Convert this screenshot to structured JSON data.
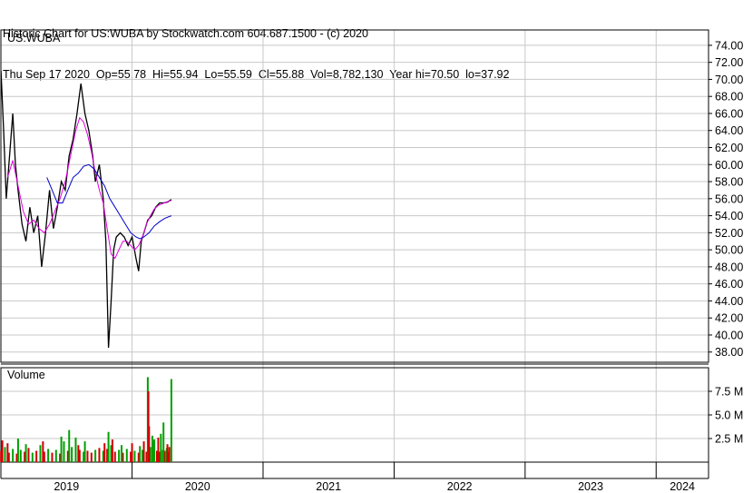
{
  "header": {
    "line1": "Historic Chart for US:WUBA by Stockwatch.com 604.687.1500 - (c) 2020",
    "line2": "Thu Sep 17 2020  Op=55.78  Hi=55.94  Lo=55.59  Cl=55.88  Vol=8,782,130  Year hi=70.50  lo=37.92"
  },
  "chart_data": {
    "type": "line",
    "symbol_label": "US:WUBA",
    "volume_label": "Volume",
    "price_axis": {
      "range": [
        36.8,
        75.8
      ],
      "ticks": [
        "74.00",
        "72.00",
        "70.00",
        "68.00",
        "66.00",
        "64.00",
        "62.00",
        "60.00",
        "58.00",
        "56.00",
        "54.00",
        "52.00",
        "50.00",
        "48.00",
        "46.00",
        "44.00",
        "42.00",
        "40.00",
        "38.00"
      ]
    },
    "volume_axis": {
      "range": [
        0,
        10
      ],
      "unit": "M",
      "ticks": [
        "7.5 M",
        "5.0 M",
        "2.5 M"
      ]
    },
    "x_axis": {
      "years": [
        "2019",
        "2020",
        "2021",
        "2022",
        "2023",
        "2024"
      ],
      "year_start": [
        2018.999,
        2020.0,
        2021.0,
        2022.0,
        2023.0,
        2024.0
      ],
      "range": [
        2018.999,
        2024.4
      ]
    },
    "colors": {
      "price": "#000000",
      "ma_short": "#e000e0",
      "ma_long": "#0000c8",
      "vol_up": "#00a000",
      "vol_down": "#d00000",
      "grid": "#c8c8c8"
    },
    "series": [
      {
        "key": "close",
        "points": [
          [
            2019.0,
            71.0
          ],
          [
            2019.02,
            64.0
          ],
          [
            2019.04,
            56.0
          ],
          [
            2019.06,
            60.0
          ],
          [
            2019.09,
            66.0
          ],
          [
            2019.11,
            60.0
          ],
          [
            2019.13,
            57.0
          ],
          [
            2019.16,
            53.0
          ],
          [
            2019.19,
            51.0
          ],
          [
            2019.22,
            55.0
          ],
          [
            2019.25,
            52.0
          ],
          [
            2019.28,
            54.0
          ],
          [
            2019.31,
            48.0
          ],
          [
            2019.34,
            52.0
          ],
          [
            2019.37,
            57.0
          ],
          [
            2019.4,
            52.5
          ],
          [
            2019.43,
            55.0
          ],
          [
            2019.46,
            58.0
          ],
          [
            2019.49,
            57.0
          ],
          [
            2019.52,
            61.0
          ],
          [
            2019.55,
            63.0
          ],
          [
            2019.58,
            66.0
          ],
          [
            2019.61,
            69.5
          ],
          [
            2019.64,
            66.0
          ],
          [
            2019.67,
            64.0
          ],
          [
            2019.7,
            61.0
          ],
          [
            2019.72,
            58.0
          ],
          [
            2019.75,
            60.0
          ],
          [
            2019.78,
            56.0
          ],
          [
            2019.8,
            51.0
          ],
          [
            2019.81,
            45.0
          ],
          [
            2019.82,
            38.5
          ],
          [
            2019.84,
            44.0
          ],
          [
            2019.86,
            50.0
          ],
          [
            2019.88,
            51.5
          ],
          [
            2019.91,
            52.0
          ],
          [
            2019.94,
            51.5
          ],
          [
            2019.97,
            50.5
          ],
          [
            2020.0,
            51.5
          ],
          [
            2020.03,
            49.0
          ],
          [
            2020.05,
            47.5
          ],
          [
            2020.07,
            51.0
          ],
          [
            2020.09,
            52.0
          ],
          [
            2020.12,
            53.5
          ],
          [
            2020.15,
            54.0
          ],
          [
            2020.18,
            55.0
          ],
          [
            2020.21,
            55.5
          ],
          [
            2020.24,
            55.5
          ],
          [
            2020.27,
            55.6
          ],
          [
            2020.3,
            55.9
          ]
        ]
      },
      {
        "key": "ma_short",
        "points": [
          [
            2019.05,
            58.5
          ],
          [
            2019.09,
            60.5
          ],
          [
            2019.13,
            57.5
          ],
          [
            2019.17,
            54.5
          ],
          [
            2019.21,
            53.0
          ],
          [
            2019.25,
            53.5
          ],
          [
            2019.29,
            52.5
          ],
          [
            2019.33,
            52.0
          ],
          [
            2019.37,
            53.0
          ],
          [
            2019.41,
            54.5
          ],
          [
            2019.45,
            56.0
          ],
          [
            2019.49,
            58.0
          ],
          [
            2019.53,
            61.0
          ],
          [
            2019.57,
            64.0
          ],
          [
            2019.6,
            65.5
          ],
          [
            2019.63,
            65.0
          ],
          [
            2019.66,
            63.5
          ],
          [
            2019.69,
            61.5
          ],
          [
            2019.72,
            59.0
          ],
          [
            2019.75,
            57.0
          ],
          [
            2019.78,
            55.5
          ],
          [
            2019.81,
            52.5
          ],
          [
            2019.84,
            49.5
          ],
          [
            2019.87,
            49.0
          ],
          [
            2019.9,
            50.0
          ],
          [
            2019.93,
            51.0
          ],
          [
            2019.96,
            51.0
          ],
          [
            2019.99,
            50.5
          ],
          [
            2020.02,
            50.0
          ],
          [
            2020.05,
            50.5
          ],
          [
            2020.08,
            51.5
          ],
          [
            2020.11,
            53.0
          ],
          [
            2020.14,
            54.0
          ],
          [
            2020.17,
            54.8
          ],
          [
            2020.2,
            55.2
          ],
          [
            2020.23,
            55.4
          ],
          [
            2020.26,
            55.6
          ],
          [
            2020.3,
            55.8
          ]
        ]
      },
      {
        "key": "ma_long",
        "points": [
          [
            2019.35,
            58.5
          ],
          [
            2019.39,
            57.0
          ],
          [
            2019.43,
            55.5
          ],
          [
            2019.47,
            55.5
          ],
          [
            2019.51,
            57.0
          ],
          [
            2019.55,
            58.5
          ],
          [
            2019.59,
            59.0
          ],
          [
            2019.63,
            59.8
          ],
          [
            2019.67,
            60.0
          ],
          [
            2019.71,
            59.5
          ],
          [
            2019.75,
            58.5
          ],
          [
            2019.79,
            57.5
          ],
          [
            2019.83,
            56.0
          ],
          [
            2019.87,
            55.0
          ],
          [
            2019.91,
            54.0
          ],
          [
            2019.95,
            53.0
          ],
          [
            2019.99,
            52.0
          ],
          [
            2020.03,
            51.5
          ],
          [
            2020.06,
            51.3
          ],
          [
            2020.09,
            51.5
          ],
          [
            2020.13,
            52.0
          ],
          [
            2020.17,
            52.8
          ],
          [
            2020.21,
            53.3
          ],
          [
            2020.25,
            53.7
          ],
          [
            2020.3,
            54.0
          ]
        ]
      }
    ],
    "volume": [
      {
        "x": 2019.0,
        "v": 1.2,
        "up": false
      },
      {
        "x": 2019.03,
        "v": 1.6,
        "up": true
      },
      {
        "x": 2019.06,
        "v": 1.0,
        "up": false
      },
      {
        "x": 2019.09,
        "v": 1.4,
        "up": true
      },
      {
        "x": 2019.12,
        "v": 0.9,
        "up": false
      },
      {
        "x": 2019.15,
        "v": 1.3,
        "up": true
      },
      {
        "x": 2019.18,
        "v": 1.1,
        "up": false
      },
      {
        "x": 2019.21,
        "v": 1.5,
        "up": false
      },
      {
        "x": 2019.24,
        "v": 1.0,
        "up": true
      },
      {
        "x": 2019.27,
        "v": 1.2,
        "up": false
      },
      {
        "x": 2019.3,
        "v": 1.8,
        "up": true
      },
      {
        "x": 2019.33,
        "v": 1.1,
        "up": false
      },
      {
        "x": 2019.36,
        "v": 1.4,
        "up": true
      },
      {
        "x": 2019.39,
        "v": 1.0,
        "up": false
      },
      {
        "x": 2019.42,
        "v": 1.3,
        "up": true
      },
      {
        "x": 2019.45,
        "v": 0.9,
        "up": false
      },
      {
        "x": 2019.48,
        "v": 2.2,
        "up": true
      },
      {
        "x": 2019.51,
        "v": 1.2,
        "up": false
      },
      {
        "x": 2019.54,
        "v": 1.6,
        "up": true
      },
      {
        "x": 2019.57,
        "v": 2.6,
        "up": true
      },
      {
        "x": 2019.6,
        "v": 1.3,
        "up": false
      },
      {
        "x": 2019.63,
        "v": 1.1,
        "up": true
      },
      {
        "x": 2019.66,
        "v": 1.2,
        "up": false
      },
      {
        "x": 2019.69,
        "v": 1.0,
        "up": false
      },
      {
        "x": 2019.72,
        "v": 1.3,
        "up": true
      },
      {
        "x": 2019.75,
        "v": 1.5,
        "up": false
      },
      {
        "x": 2019.78,
        "v": 1.2,
        "up": true
      },
      {
        "x": 2019.81,
        "v": 1.4,
        "up": false
      },
      {
        "x": 2019.84,
        "v": 1.8,
        "up": true
      },
      {
        "x": 2019.87,
        "v": 1.1,
        "up": false
      },
      {
        "x": 2019.9,
        "v": 1.3,
        "up": true
      },
      {
        "x": 2019.93,
        "v": 1.0,
        "up": false
      },
      {
        "x": 2019.96,
        "v": 1.4,
        "up": true
      },
      {
        "x": 2019.99,
        "v": 1.1,
        "up": false
      },
      {
        "x": 2020.02,
        "v": 1.2,
        "up": true
      },
      {
        "x": 2020.05,
        "v": 1.0,
        "up": false
      },
      {
        "x": 2020.08,
        "v": 1.3,
        "up": true
      },
      {
        "x": 2020.11,
        "v": 1.1,
        "up": false
      },
      {
        "x": 2020.14,
        "v": 1.6,
        "up": true
      },
      {
        "x": 2020.17,
        "v": 2.4,
        "up": true
      },
      {
        "x": 2020.19,
        "v": 1.2,
        "up": false
      },
      {
        "x": 2020.21,
        "v": 1.1,
        "up": false
      },
      {
        "x": 2020.235,
        "v": 1.3,
        "up": true
      },
      {
        "x": 2020.25,
        "v": 1.2,
        "up": false
      },
      {
        "x": 2020.265,
        "v": 1.5,
        "up": true
      },
      {
        "x": 2020.28,
        "v": 1.1,
        "up": false
      },
      {
        "x": 2020.3,
        "v": 8.8,
        "up": true
      },
      {
        "x": 2019.01,
        "v": 2.3,
        "up": false
      },
      {
        "x": 2019.05,
        "v": 2.0,
        "up": false
      },
      {
        "x": 2019.13,
        "v": 2.5,
        "up": true
      },
      {
        "x": 2019.19,
        "v": 1.9,
        "up": true
      },
      {
        "x": 2019.32,
        "v": 2.2,
        "up": false
      },
      {
        "x": 2019.46,
        "v": 2.7,
        "up": true
      },
      {
        "x": 2019.52,
        "v": 3.4,
        "up": true
      },
      {
        "x": 2019.59,
        "v": 1.8,
        "up": false
      },
      {
        "x": 2019.64,
        "v": 2.2,
        "up": true
      },
      {
        "x": 2019.79,
        "v": 2.0,
        "up": false
      },
      {
        "x": 2019.82,
        "v": 3.2,
        "up": true
      },
      {
        "x": 2019.85,
        "v": 2.4,
        "up": false
      },
      {
        "x": 2019.92,
        "v": 1.8,
        "up": true
      },
      {
        "x": 2020.0,
        "v": 2.0,
        "up": false
      },
      {
        "x": 2020.06,
        "v": 1.7,
        "up": true
      },
      {
        "x": 2020.09,
        "v": 2.2,
        "up": false
      },
      {
        "x": 2020.12,
        "v": 9.0,
        "up": true
      },
      {
        "x": 2020.125,
        "v": 7.5,
        "up": false
      },
      {
        "x": 2020.13,
        "v": 3.8,
        "up": false
      },
      {
        "x": 2020.155,
        "v": 2.8,
        "up": true
      },
      {
        "x": 2020.165,
        "v": 2.2,
        "up": true
      },
      {
        "x": 2020.2,
        "v": 2.6,
        "up": false
      },
      {
        "x": 2020.22,
        "v": 3.0,
        "up": true
      },
      {
        "x": 2020.24,
        "v": 4.2,
        "up": true
      },
      {
        "x": 2020.27,
        "v": 1.9,
        "up": false
      },
      {
        "x": 2020.285,
        "v": 1.6,
        "up": false
      }
    ]
  }
}
